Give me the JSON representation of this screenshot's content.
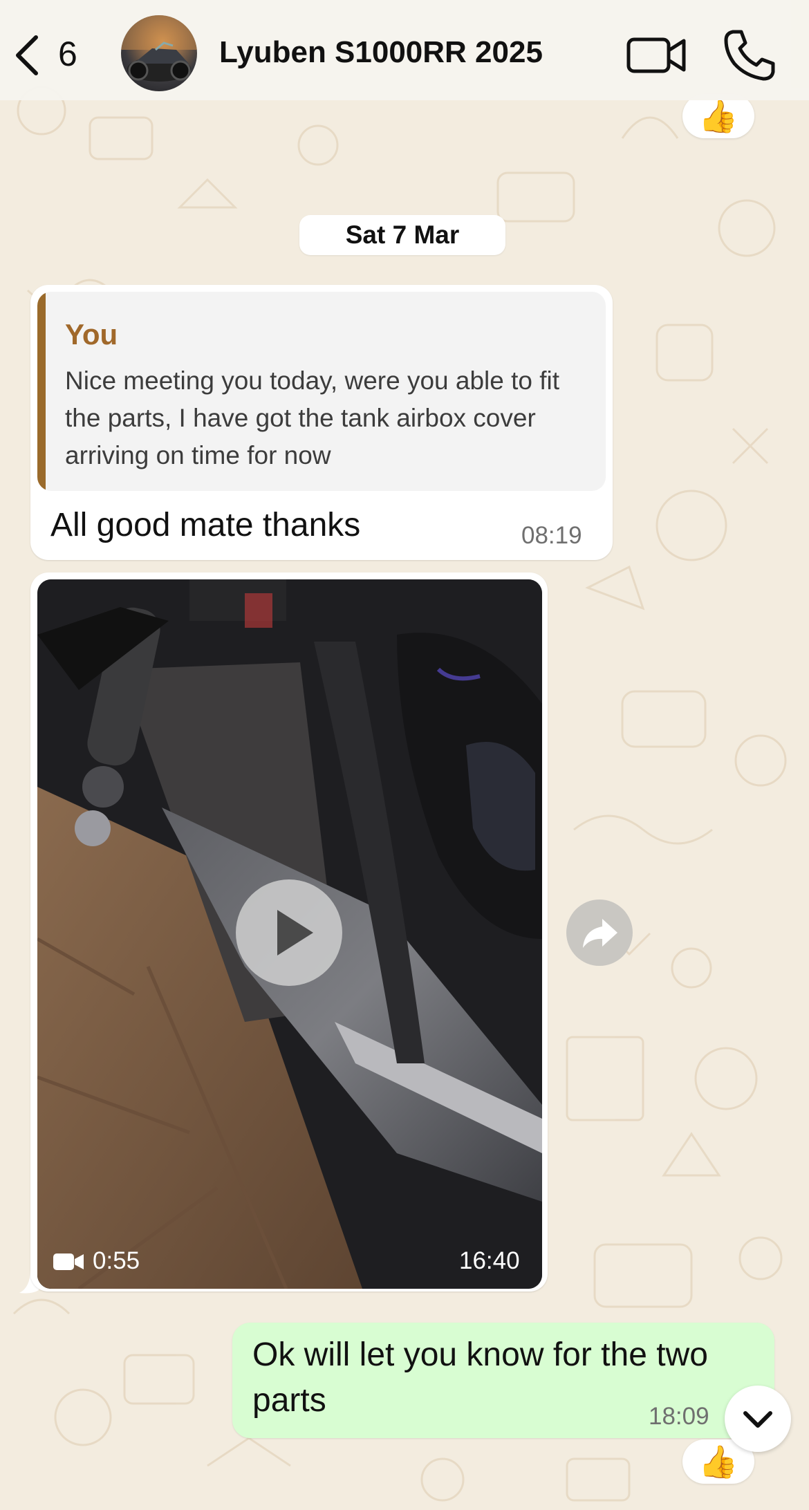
{
  "header": {
    "back_count": "6",
    "contact_name": "Lyuben S1000RR 2025"
  },
  "reactions": {
    "top": "👍",
    "bottom": "👍"
  },
  "date_separator": "Sat 7 Mar",
  "messages": [
    {
      "direction": "incoming",
      "quote": {
        "author": "You",
        "text": "Nice meeting you today, were you able to fit the parts, I have got the tank airbox cover arriving on time for now"
      },
      "text": "All good mate thanks",
      "time": "08:19"
    },
    {
      "direction": "incoming",
      "type": "video",
      "duration": "0:55",
      "time": "16:40"
    },
    {
      "direction": "outgoing",
      "text": "Ok will let you know for the two parts",
      "time": "18:09"
    }
  ],
  "colors": {
    "chat_background": "#f3ecdf",
    "outgoing_bubble": "#d8fdd2",
    "incoming_bubble": "#ffffff",
    "quote_accent": "#9a6a2b"
  },
  "icons": [
    "chevron-left-icon",
    "video-camera-icon",
    "phone-icon",
    "play-icon",
    "forward-icon",
    "video-small-icon",
    "chevron-down-icon"
  ]
}
